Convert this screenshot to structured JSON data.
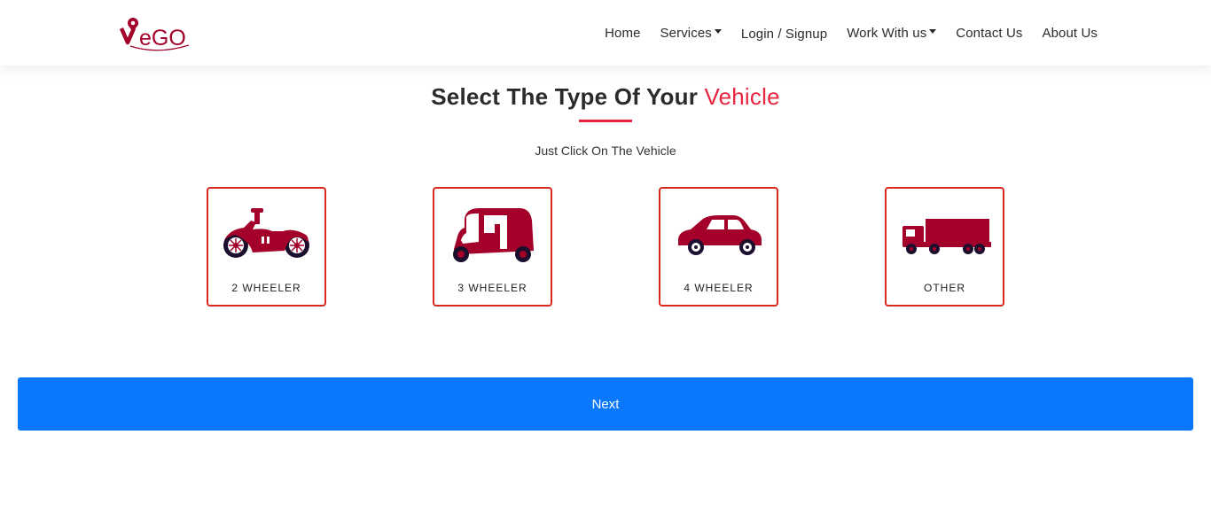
{
  "brand": {
    "logo_text": "eGO"
  },
  "nav": {
    "home": "Home",
    "services": "Services",
    "login": "Login / Signup",
    "work": "Work With us",
    "contact": "Contact Us",
    "about": "About Us"
  },
  "heading": {
    "main": "Select The Type Of Your",
    "accent": "Vehicle"
  },
  "subtitle": "Just Click On The Vehicle",
  "vehicles": [
    {
      "label": "2 WHEELER",
      "icon": "motorcycle-icon"
    },
    {
      "label": "3 WHEELER",
      "icon": "auto-rickshaw-icon"
    },
    {
      "label": "4 WHEELER",
      "icon": "car-icon"
    },
    {
      "label": "OTHER",
      "icon": "truck-icon"
    }
  ],
  "next_label": "Next",
  "colors": {
    "brand": "#a3002a",
    "accent": "#e8243f",
    "card_border": "#d9281f",
    "button": "#0a78fc"
  }
}
